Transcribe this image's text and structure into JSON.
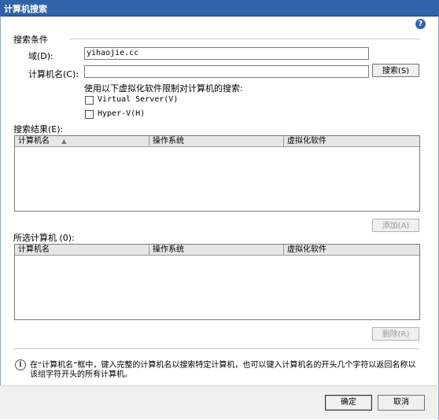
{
  "window": {
    "title": "计算机搜索"
  },
  "help_icon": "?",
  "search_criteria": {
    "legend": "搜索条件",
    "domain_label": "域(D):",
    "domain_value": "yihaojie.cc",
    "computer_label": "计算机名(C):",
    "computer_value": "",
    "search_button": "搜索(S)",
    "virtualization_caption": "使用以下虚拟化软件限制对计算机的搜索:",
    "checkboxes": [
      {
        "label": "Virtual Server(V)",
        "checked": false
      },
      {
        "label": "Hyper-V(H)",
        "checked": false
      }
    ]
  },
  "results": {
    "label": "搜索结果(E):",
    "columns": [
      "计算机名",
      "操作系统",
      "虚拟化软件"
    ],
    "sort_indicator": "▲",
    "rows": [],
    "add_button": "添加(A)"
  },
  "selected": {
    "label": "所选计算机 (0):",
    "columns": [
      "计算机名",
      "操作系统",
      "虚拟化软件"
    ],
    "rows": [],
    "remove_button": "删除(R)"
  },
  "info": {
    "text_line1": "在“计算机名”框中，键入完整的计算机名以搜索特定计算机，也可以键入计算机名的开头几个字符以返回名称以",
    "text_line2": "该组字符开头的所有计算机。"
  },
  "footer": {
    "ok_button": "确定",
    "cancel_button": "取消"
  },
  "colors": {
    "titlebar": "#2f62a8",
    "disabled_text": "#9a9a9a"
  }
}
